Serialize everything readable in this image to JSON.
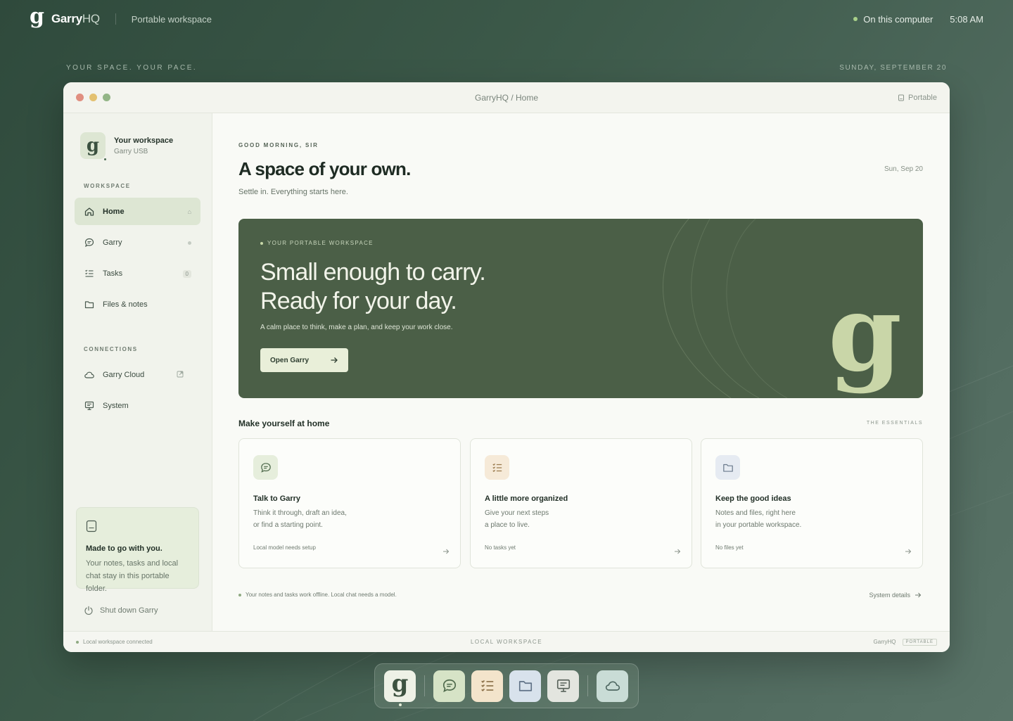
{
  "topbar": {
    "brand_logo": "g",
    "brand_name": "Garry",
    "brand_suffix": "HQ",
    "subtitle": "Portable workspace",
    "status": "On this computer",
    "time": "5:08 AM"
  },
  "tagline": "YOUR SPACE. YOUR PACE.",
  "date_top": "SUNDAY, SEPTEMBER 20",
  "window": {
    "title": "GarryHQ / Home",
    "portable_label": "Portable"
  },
  "sidebar": {
    "workspace_logo": "g",
    "workspace_title": "Your workspace",
    "workspace_sub": "Garry USB",
    "section_workspace": "WORKSPACE",
    "items": [
      {
        "label": "Home",
        "icon": "home-icon"
      },
      {
        "label": "Garry",
        "icon": "chat-icon"
      },
      {
        "label": "Tasks",
        "icon": "tasks-icon",
        "badge": "0"
      },
      {
        "label": "Files & notes",
        "icon": "folder-icon"
      }
    ],
    "section_connections": "CONNECTIONS",
    "connections": [
      {
        "label": "Garry Cloud",
        "icon": "cloud-icon"
      },
      {
        "label": "System",
        "icon": "monitor-icon"
      }
    ],
    "promo_title": "Made to go with you.",
    "promo_text": "Your notes, tasks and local chat stay in this portable folder.",
    "shutdown": "Shut down Garry"
  },
  "main": {
    "greeting": "GOOD MORNING, SIR",
    "title": "A space of your own.",
    "subtitle": "Settle in. Everything starts here.",
    "date": "Sun, Sep 20",
    "hero": {
      "kicker": "YOUR PORTABLE WORKSPACE",
      "line1": "Small enough to carry.",
      "line2": "Ready for your day.",
      "text": "A calm place to think, make a plan, and keep your work close.",
      "button": "Open Garry",
      "logo": "g"
    },
    "section_title": "Make yourself at home",
    "section_right": "THE ESSENTIALS",
    "cards": [
      {
        "title": "Talk to Garry",
        "line1": "Think it through, draft an idea,",
        "line2": "or find a starting point.",
        "foot": "Local model needs setup",
        "icon": "chat-icon",
        "color": "#e6eedc"
      },
      {
        "title": "A little more organized",
        "line1": "Give your next steps",
        "line2": "a place to live.",
        "foot": "No tasks yet",
        "icon": "tasks-icon",
        "color": "#f6ead8"
      },
      {
        "title": "Keep the good ideas",
        "line1": "Notes and files, right here",
        "line2": "in your portable workspace.",
        "foot": "No files yet",
        "icon": "folder-icon",
        "color": "#e6ebf2"
      }
    ],
    "offline_note": "Your notes and tasks work offline. Local chat needs a model.",
    "system_details": "System details"
  },
  "statusbar": {
    "left": "Local workspace connected",
    "center": "LOCAL WORKSPACE",
    "right": "GarryHQ",
    "badge": "PORTABLE"
  },
  "dock": {
    "logo": "g",
    "items": [
      "garry-logo",
      "chat-icon",
      "tasks-icon",
      "folder-icon",
      "monitor-icon",
      "cloud-icon"
    ]
  }
}
